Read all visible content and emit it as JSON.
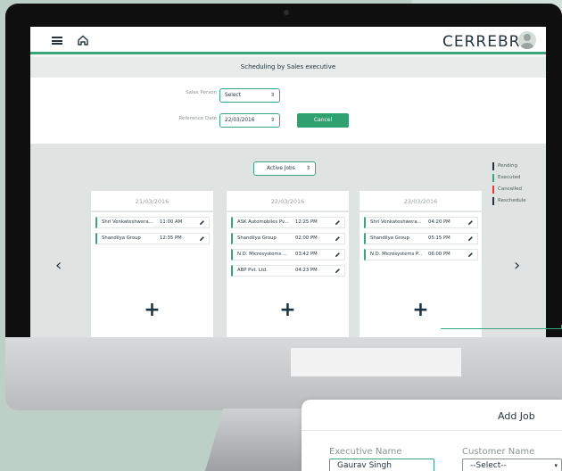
{
  "topbar": {
    "brand_prefix": "CERREBR",
    "brand_suffix": "Q"
  },
  "page": {
    "subtitle": "Scheduling by Sales executive"
  },
  "form": {
    "sales_person_label": "Sales Person",
    "sales_person_value": "Select",
    "reference_date_label": "Reference Date",
    "reference_date_value": "22/03/2016",
    "cancel_label": "Cancel"
  },
  "board": {
    "filter_value": "Active Jobs",
    "legend": [
      {
        "label": "Pending",
        "color": "#25343d"
      },
      {
        "label": "Executed",
        "color": "#3aa57a"
      },
      {
        "label": "Cancelled",
        "color": "#e53935"
      },
      {
        "label": "Reschedule",
        "color": "#25343d"
      }
    ],
    "columns": [
      {
        "date": "21/03/2016",
        "jobs": [
          {
            "name": "Shri Venkateshwera...",
            "time": "11:00 AM"
          },
          {
            "name": "Shandilya Group",
            "time": "12:35 PM"
          }
        ]
      },
      {
        "date": "22/03/2016",
        "jobs": [
          {
            "name": "ASK Automobiles Pv...",
            "time": "12:25 PM"
          },
          {
            "name": "Shandilya Group",
            "time": "02:00 PM"
          },
          {
            "name": "N.D. Microsystems ...",
            "time": "03:42 PM"
          },
          {
            "name": "ABP Pvt. Ltd.",
            "time": "04:23 PM"
          }
        ]
      },
      {
        "date": "23/03/2016",
        "jobs": [
          {
            "name": "Shri Venkateshwera...",
            "time": "04:20 PM"
          },
          {
            "name": "Shandilya Group",
            "time": "05:15 PM"
          },
          {
            "name": "N.D. Microsystems P...",
            "time": "06:00 PM"
          }
        ]
      }
    ],
    "add_symbol": "+",
    "prev_symbol": "‹",
    "next_symbol": "›"
  },
  "modal": {
    "title": "Add Job",
    "executive_label": "Executive Name",
    "executive_value": "Gaurav Singh",
    "customer_label": "Customer Name",
    "customer_value": "--Select--"
  },
  "colors": {
    "accent": "#3aa57a",
    "dark": "#25343d"
  }
}
